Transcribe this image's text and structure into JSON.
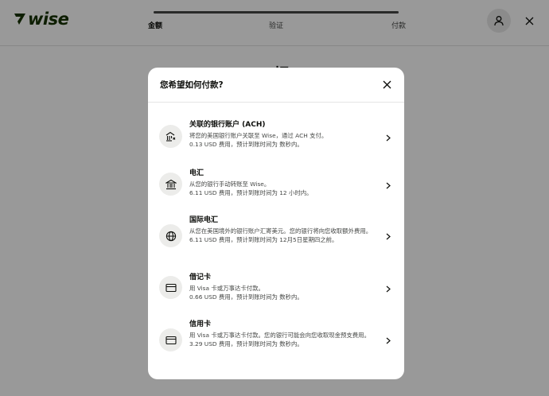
{
  "header": {
    "logo_text": "wise",
    "steps": [
      "金额",
      "验证",
      "付款"
    ],
    "active_step": 0,
    "progress_fraction": 1.0
  },
  "page": {
    "heading_partial": "一切"
  },
  "modal": {
    "title": "您希望如何付款?",
    "options": [
      {
        "icon": "bank-link-icon",
        "title": "关联的银行账户 (ACH)",
        "description": "将您的美国银行账户关联至 Wise，通过 ACH 支付。",
        "fee": "0.13 USD 费用，预计到账时间为 数秒内。"
      },
      {
        "icon": "bank-icon",
        "title": "电汇",
        "description": "从您的银行手动转账至 Wise。",
        "fee": "6.11 USD 费用，预计到账时间为 12 小时内。"
      },
      {
        "icon": "globe-icon",
        "title": "国际电汇",
        "description": "从您在美国境外的银行账户汇寄美元。您的银行将向您收取额外费用。",
        "fee": "6.11 USD 费用，预计到账时间为 12月5日星期四之前。"
      },
      {
        "icon": "card-icon",
        "title": "借记卡",
        "description": "用 Visa 卡或万事达卡付款。",
        "fee": "0.66 USD 费用，预计到账时间为 数秒内。"
      },
      {
        "icon": "card-icon",
        "title": "信用卡",
        "description": "用 Visa 卡或万事达卡付款。您的银行可能会向您收取现金预支费用。",
        "fee": "3.29 USD 费用，预计到账时间为 数秒内。"
      }
    ]
  },
  "colors": {
    "brand": "#163300",
    "overlay": "rgba(0,0,0,0.4)",
    "icon_bg": "#ececea"
  }
}
